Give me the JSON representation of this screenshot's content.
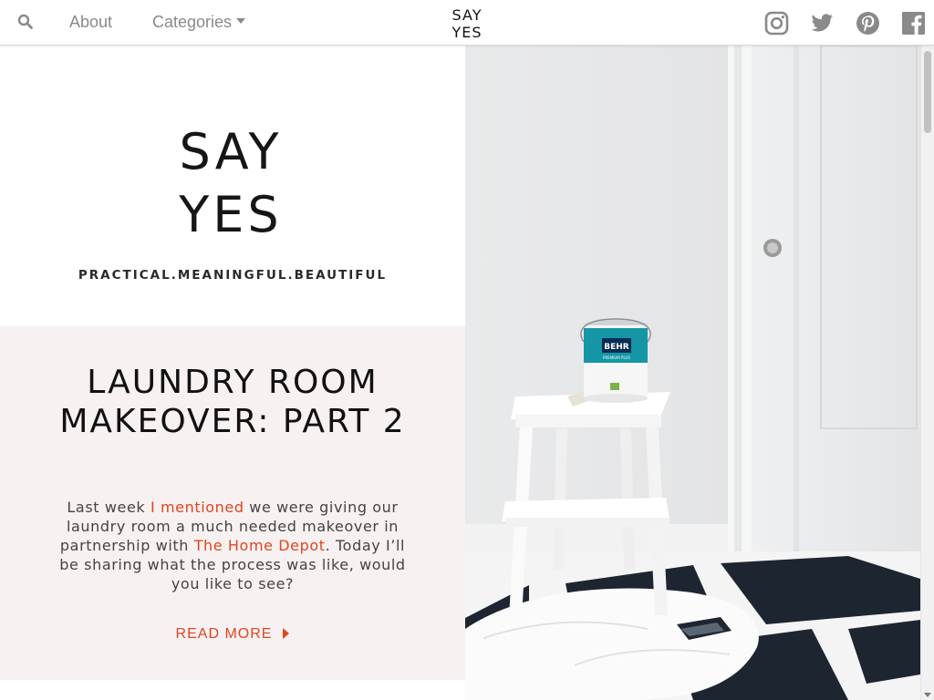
{
  "nav": {
    "search_icon": "search-icon",
    "about_label": "About",
    "categories_label": "Categories",
    "logo_line1": "SAY",
    "logo_line2": "YES",
    "social": [
      "instagram-icon",
      "twitter-icon",
      "pinterest-icon",
      "facebook-icon"
    ]
  },
  "hero": {
    "logo_line1": "SAY",
    "logo_line2": "YES",
    "tagline": "PRACTICAL.MEANINGFUL.BEAUTIFUL"
  },
  "post": {
    "title": "LAUNDRY ROOM MAKEOVER: PART 2",
    "excerpt_part1": "Last week ",
    "excerpt_link1": "I mentioned",
    "excerpt_part2": " we were giving our laundry room a much needed makeover in partnership with ",
    "excerpt_link2": "The Home Depot",
    "excerpt_part3": ". Today I’ll be sharing what the process was like, would you like to see?",
    "read_more": "READ MORE"
  },
  "photo": {
    "can_brand": "BEHR",
    "can_sub": "PREMIUM PLUS"
  },
  "colors": {
    "accent": "#e0451f",
    "card_bg": "#f7f1f1",
    "nav_text": "#8a8a8a"
  }
}
